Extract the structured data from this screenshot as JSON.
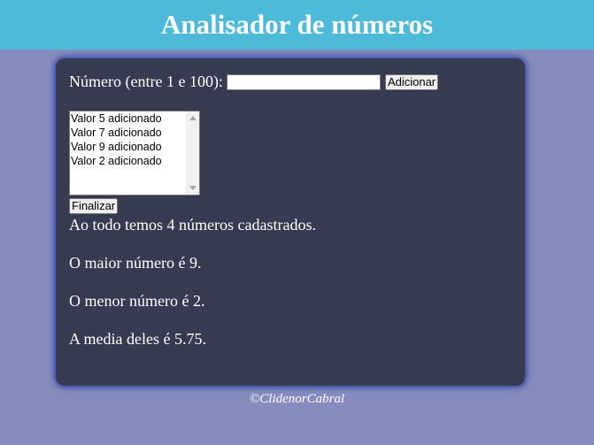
{
  "header": {
    "title": "Analisador de números"
  },
  "form": {
    "label": "Número (entre 1 e 100):",
    "input_value": "",
    "add_button": "Adicionar",
    "finish_button": "Finalizar"
  },
  "list": {
    "items": [
      "Valor 5 adicionado",
      "Valor 7 adicionado",
      "Valor 9 adicionado",
      "Valor 2 adicionado"
    ]
  },
  "results": {
    "total": "Ao todo temos 4 números cadastrados.",
    "max": "O maior número é 9.",
    "min": "O menor número é 2.",
    "avg": "A media deles é 5.75."
  },
  "footer": {
    "text": "©ClidenorCabral"
  },
  "colors": {
    "header_bg": "#4dbad9",
    "page_bg": "#858cbd",
    "panel_bg": "#363b52",
    "panel_glow": "#2f45a8"
  }
}
